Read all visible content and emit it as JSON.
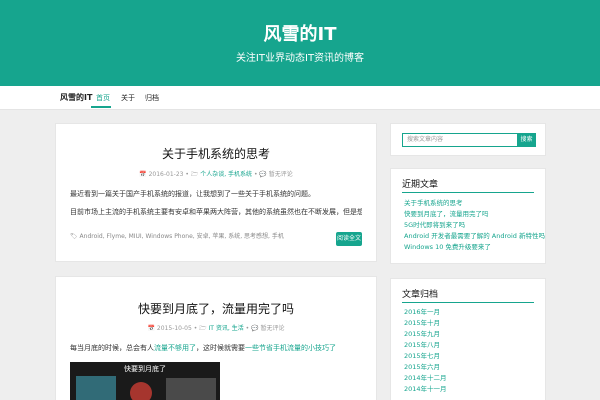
{
  "site": {
    "title": "风雪的IT",
    "description": "关注IT业界动态IT资讯的博客"
  },
  "nav": {
    "brand": "风雪的IT",
    "items": [
      "首页",
      "关于",
      "归档"
    ]
  },
  "posts": [
    {
      "title": "关于手机系统的思考",
      "date": "2016-01-23",
      "categories": "个人杂谈, 手机系统",
      "comments": "暂无评论",
      "paragraphs": [
        "最近看到一篇关于国产手机系统的报道，让我想到了一些关于手机系统的问题。",
        "目前市场上主流的手机系统主要有安卓和苹果两大阵营，其他的系统虽然也在不断发展，但是想要撼动这两大巨头的地位还是非常困难的一件事情啊。"
      ],
      "tags": "Android, Flyme, MIUI, Windows Phone, 安卓, 苹果, 系统, 思考感想, 手机",
      "more": "阅读全文"
    },
    {
      "title": "快要到月底了，流量用完了吗",
      "date": "2015-10-05",
      "categories": "IT 资讯, 生活",
      "comments": "暂无评论",
      "paragraph_start": "每当月底的时候，总会有人",
      "paragraph_link1": "流量不够用了",
      "paragraph_mid": "，这时候就需要",
      "paragraph_link2": "一些节省手机流量的小技巧了",
      "image_caption": "快要到月底了"
    }
  ],
  "sidebar": {
    "search_placeholder": "搜索文章内容",
    "search_button": "搜索",
    "recent": {
      "title": "近期文章",
      "items": [
        "关于手机系统的思考",
        "快要到月底了，流量用完了吗",
        "5G时代即将到来了吗",
        "Android 开发者最需要了解的 Android 新特性吗",
        "Windows 10 免费升级要来了"
      ]
    },
    "archive": {
      "title": "文章归档",
      "items": [
        "2016年一月",
        "2015年十月",
        "2015年九月",
        "2015年八月",
        "2015年七月",
        "2015年六月",
        "2014年十二月",
        "2014年十一月"
      ]
    }
  },
  "colors": {
    "accent": "#16a58e",
    "background": "#eeeeee"
  }
}
